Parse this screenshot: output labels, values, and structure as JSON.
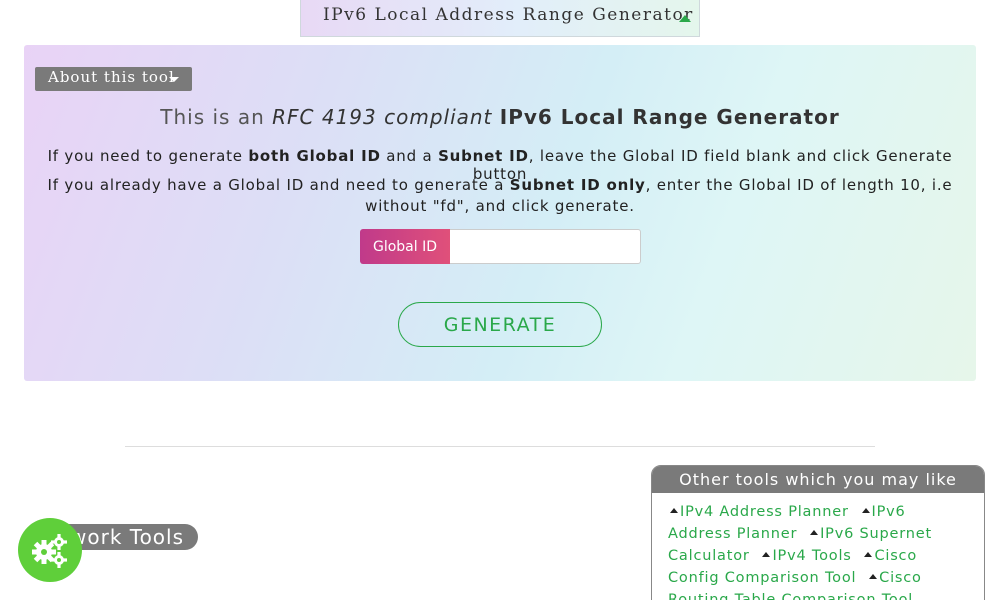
{
  "top_tab": {
    "title": "IPv6 Local Address Range Generator"
  },
  "about": {
    "label": "About this tool"
  },
  "headline": {
    "part1": "This is an",
    "part2": "RFC 4193 compliant",
    "part3": "IPv6 Local Range Generator"
  },
  "instructions": {
    "line1": {
      "a": "If you need to generate",
      "b": "both Global ID",
      "c": "and a",
      "d": "Subnet ID",
      "e": ", leave the Global ID field blank and click Generate button"
    },
    "line2": {
      "a": "If you already have a Global ID and need to generate a",
      "b": "Subnet ID only",
      "c": ", enter the Global ID of length 10, i.e without \"fd\", and click generate."
    }
  },
  "form": {
    "global_id_label": "Global ID",
    "global_id_value": "",
    "generate_label": "GENERATE"
  },
  "footer": {
    "network_tools_label": "work Tools"
  },
  "other_tools": {
    "heading": "Other tools which you may like",
    "links": [
      "IPv4 Address Planner",
      "IPv6 Address Planner",
      "IPv6 Supernet Calculator",
      "IPv4 Tools",
      "Cisco Config Comparison Tool",
      "Cisco Routing Table Comparison Tool"
    ]
  },
  "colors": {
    "accent_green": "#2aa84a",
    "label_pink": "#c03a8a",
    "pill_gray": "#7a7a7a",
    "fab_green": "#5fcf3a"
  }
}
